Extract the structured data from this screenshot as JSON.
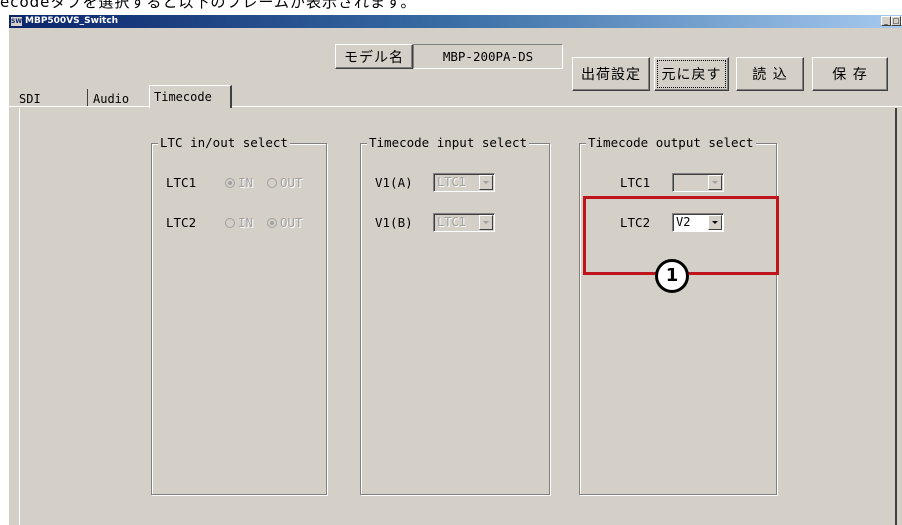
{
  "document": {
    "caption": "ecodeタブを選択すると以下のフレームが表示されます。"
  },
  "window": {
    "title": "MBP500VS_Switch",
    "icon_text": "SW",
    "controls": {
      "minimize": "_",
      "maximize": "□",
      "close": "×"
    }
  },
  "header": {
    "model_label": "モデル名",
    "model_value": "MBP-200PA-DS",
    "buttons": {
      "factory": "出荷設定",
      "restore": "元に戻す",
      "load": "読 込",
      "save": "保 存"
    }
  },
  "tabs": [
    {
      "label": "SDI",
      "active": false
    },
    {
      "label": "Audio",
      "active": false
    },
    {
      "label": "Timecode",
      "active": true
    }
  ],
  "groups": {
    "ltc_inout": {
      "title": "LTC in/out select",
      "rows": [
        {
          "label": "LTC1",
          "options": [
            "IN",
            "OUT"
          ],
          "selected": "IN"
        },
        {
          "label": "LTC2",
          "options": [
            "IN",
            "OUT"
          ],
          "selected": "OUT"
        }
      ]
    },
    "tc_input": {
      "title": "Timecode input select",
      "rows": [
        {
          "label": "V1(A)",
          "value": "LTC1",
          "enabled": false
        },
        {
          "label": "V1(B)",
          "value": "LTC1",
          "enabled": false
        }
      ]
    },
    "tc_output": {
      "title": "Timecode output select",
      "rows": [
        {
          "label": "LTC1",
          "value": "",
          "enabled": false
        },
        {
          "label": "LTC2",
          "value": "V2",
          "enabled": true
        }
      ]
    }
  },
  "annotation": {
    "marker": "1",
    "highlight_color": "#c0141c"
  }
}
